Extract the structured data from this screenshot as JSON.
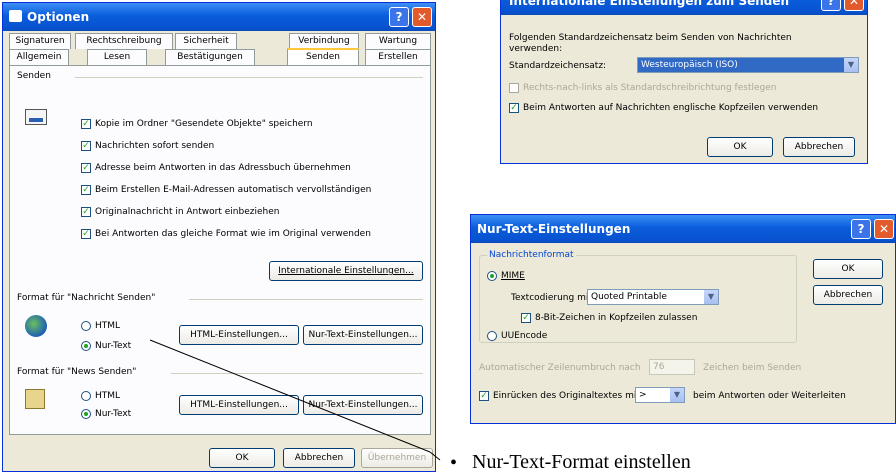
{
  "optionen": {
    "title": "Optionen",
    "tabs_row1": [
      "Signaturen",
      "Rechtschreibung",
      "Sicherheit",
      "Verbindung",
      "Wartung"
    ],
    "tabs_row2": [
      "Allgemein",
      "Lesen",
      "Bestätigungen",
      "Senden",
      "Erstellen"
    ],
    "section_senden": "Senden",
    "checks": [
      "Kopie im Ordner \"Gesendete Objekte\" speichern",
      "Nachrichten sofort senden",
      "Adresse beim Antworten in das Adressbuch übernehmen",
      "Beim Erstellen E-Mail-Adressen automatisch vervollständigen",
      "Originalnachricht in Antwort einbeziehen",
      "Bei Antworten das gleiche Format wie im Original verwenden"
    ],
    "intl_button": "Internationale Einstellungen...",
    "section_mail": "Format für \"Nachricht Senden\"",
    "mail_html": "HTML",
    "mail_text": "Nur-Text",
    "section_news": "Format für \"News Senden\"",
    "news_html": "HTML",
    "news_text": "Nur-Text",
    "html_settings": "HTML-Einstellungen...",
    "text_settings": "Nur-Text-Einstellungen...",
    "ok": "OK",
    "cancel": "Abbrechen",
    "apply": "Übernehmen"
  },
  "intl": {
    "title": "Internationale Einstellungen zum Senden",
    "intro": "Folgenden Standardzeichensatz beim Senden von Nachrichten verwenden:",
    "charset_label": "Standardzeichensatz:",
    "charset_value": "Westeuropäisch (ISO)",
    "rtl_option": "Rechts-nach-links als Standardschreibrichtung festlegen",
    "english_headers": "Beim Antworten auf Nachrichten englische Kopfzeilen verwenden",
    "ok": "OK",
    "cancel": "Abbrechen"
  },
  "plain": {
    "title": "Nur-Text-Einstellungen",
    "group_label": "Nachrichtenformat",
    "mime": "MIME",
    "encoding_label": "Textcodierung mit:",
    "encoding_value": "Quoted Printable",
    "eightbit": "8-Bit-Zeichen in Kopfzeilen zulassen",
    "uuencode": "UUEncode",
    "wrap_label": "Automatischer Zeilenumbruch nach",
    "wrap_value": "76",
    "wrap_suffix": "Zeichen beim Senden",
    "indent_label": "Einrücken des Originaltextes mit",
    "indent_value": ">",
    "indent_suffix": "beim Antworten oder Weiterleiten",
    "ok": "OK",
    "cancel": "Abbrechen"
  },
  "caption": "Nur-Text-Format einstellen",
  "colors": {
    "titlebar": "#0a5ddb",
    "window": "#ece9d8",
    "check": "#21a121"
  }
}
